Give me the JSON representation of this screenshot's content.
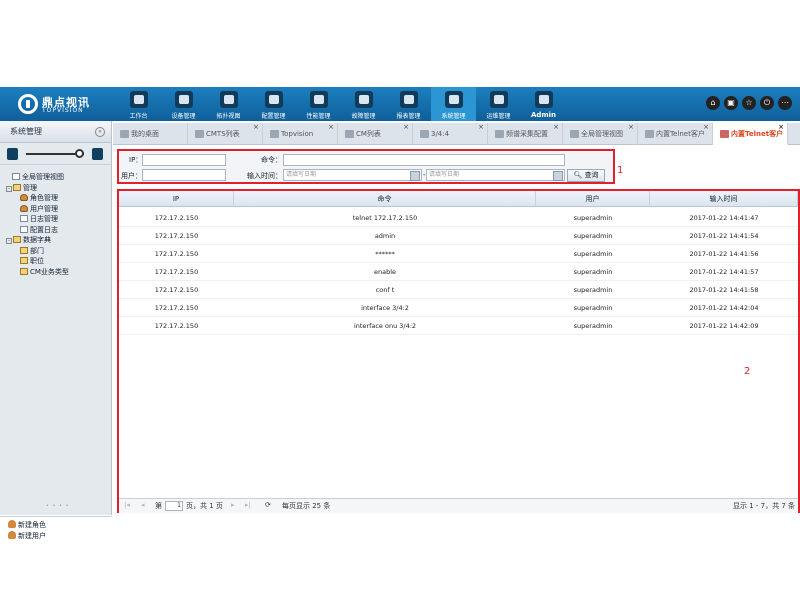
{
  "header": {
    "logo_cn": "鼎点视讯",
    "logo_en": "TOPVISION",
    "nav": [
      {
        "label": "工作台",
        "icon": "desk-icon"
      },
      {
        "label": "设备管理",
        "icon": "device-icon"
      },
      {
        "label": "拓扑视图",
        "icon": "map-pin-icon"
      },
      {
        "label": "配置管理",
        "icon": "gear-icon"
      },
      {
        "label": "性能管理",
        "icon": "gauge-icon"
      },
      {
        "label": "故障管理",
        "icon": "warning-icon"
      },
      {
        "label": "报表管理",
        "icon": "clipboard-icon"
      },
      {
        "label": "系统管理",
        "icon": "users-icon"
      },
      {
        "label": "运维管理",
        "icon": "tools-icon"
      },
      {
        "label": "Admin",
        "icon": "gear-icon"
      }
    ],
    "active_nav": "系统管理",
    "right_icons": [
      "home-icon",
      "window-icon",
      "star-icon",
      "power-icon",
      "more-icon"
    ]
  },
  "sidebar": {
    "title": "系统管理",
    "tree": [
      {
        "label": "全局管理视图",
        "level": 0,
        "icon": "page"
      },
      {
        "label": "管理",
        "level": 0,
        "icon": "folder",
        "toggle": "-"
      },
      {
        "label": "角色管理",
        "level": 1,
        "icon": "user"
      },
      {
        "label": "用户管理",
        "level": 1,
        "icon": "user"
      },
      {
        "label": "日志管理",
        "level": 1,
        "icon": "page"
      },
      {
        "label": "配置日志",
        "level": 1,
        "icon": "page"
      },
      {
        "label": "数据字典",
        "level": 0,
        "icon": "folder",
        "toggle": "-"
      },
      {
        "label": "部门",
        "level": 1,
        "icon": "folder"
      },
      {
        "label": "职位",
        "level": 1,
        "icon": "folder"
      },
      {
        "label": "CM业务类型",
        "level": 1,
        "icon": "folder"
      }
    ],
    "bottom": [
      "新建角色",
      "新建用户"
    ]
  },
  "tabs": [
    {
      "label": "我的桌面",
      "closable": false
    },
    {
      "label": "CMTS列表",
      "closable": true
    },
    {
      "label": "Topvision",
      "closable": true
    },
    {
      "label": "CM列表",
      "closable": true
    },
    {
      "label": "3/4:4",
      "closable": true
    },
    {
      "label": "频谱采集配置",
      "closable": true
    },
    {
      "label": "全局管理视图",
      "closable": true
    },
    {
      "label": "内置Telnet客户",
      "closable": true
    },
    {
      "label": "内置Telnet客户",
      "closable": true,
      "active": true
    }
  ],
  "search": {
    "ip_label": "IP：",
    "command_label": "命令：",
    "user_label": "用户：",
    "time_label": "输入时间：",
    "start_placeholder": "请填写日期",
    "end_placeholder": "请填写日期",
    "range_sep": "-",
    "query_button": "查询",
    "annotation": "1"
  },
  "grid": {
    "annotation": "2",
    "columns": [
      "IP",
      "命令",
      "用户",
      "输入时间"
    ],
    "rows": [
      [
        "172.17.2.150",
        "telnet 172.17.2.150",
        "superadmin",
        "2017-01-22 14:41:47"
      ],
      [
        "172.17.2.150",
        "admin",
        "superadmin",
        "2017-01-22 14:41:54"
      ],
      [
        "172.17.2.150",
        "******",
        "superadmin",
        "2017-01-22 14:41:56"
      ],
      [
        "172.17.2.150",
        "enable",
        "superadmin",
        "2017-01-22 14:41:57"
      ],
      [
        "172.17.2.150",
        "conf t",
        "superadmin",
        "2017-01-22 14:41:58"
      ],
      [
        "172.17.2.150",
        "interface 3/4:2",
        "superadmin",
        "2017-01-22 14:42:04"
      ],
      [
        "172.17.2.150",
        "interface onu 3/4:2",
        "superadmin",
        "2017-01-22 14:42:09"
      ]
    ],
    "pager": {
      "page_prefix": "第",
      "page_value": "1",
      "page_suffix": "页，共 1 页",
      "page_size": "每页显示 25 条",
      "summary": "显示 1 - 7，共 7 条"
    }
  }
}
